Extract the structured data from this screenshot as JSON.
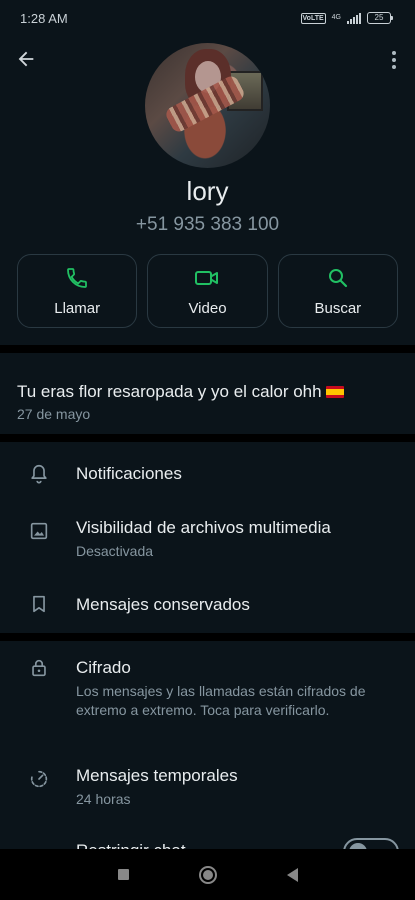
{
  "status_bar": {
    "time": "1:28 AM",
    "volte": "Vo LTE",
    "network": "4G",
    "battery": "25"
  },
  "contact": {
    "name": "lory",
    "phone": "+51 935 383 100"
  },
  "actions": [
    {
      "label": "Llamar",
      "icon": "phone-icon"
    },
    {
      "label": "Video",
      "icon": "video-icon"
    },
    {
      "label": "Buscar",
      "icon": "search-icon"
    }
  ],
  "about": {
    "text": "Tu eras flor resaropada y yo el calor ohh",
    "date": "27 de mayo"
  },
  "settings": {
    "notifications": "Notificaciones",
    "media_visibility": {
      "title": "Visibilidad de archivos multimedia",
      "subtitle": "Desactivada"
    },
    "kept_messages": "Mensajes conservados",
    "encryption": {
      "title": "Cifrado",
      "subtitle": "Los mensajes y las llamadas están cifrados de extremo a extremo. Toca para verificarlo."
    },
    "disappearing": {
      "title": "Mensajes temporales",
      "subtitle": "24 horas"
    },
    "restrict_chat": "Restringir chat"
  },
  "colors": {
    "background": "#0b141a",
    "accent": "#21c063",
    "secondary_text": "#8696a0"
  }
}
